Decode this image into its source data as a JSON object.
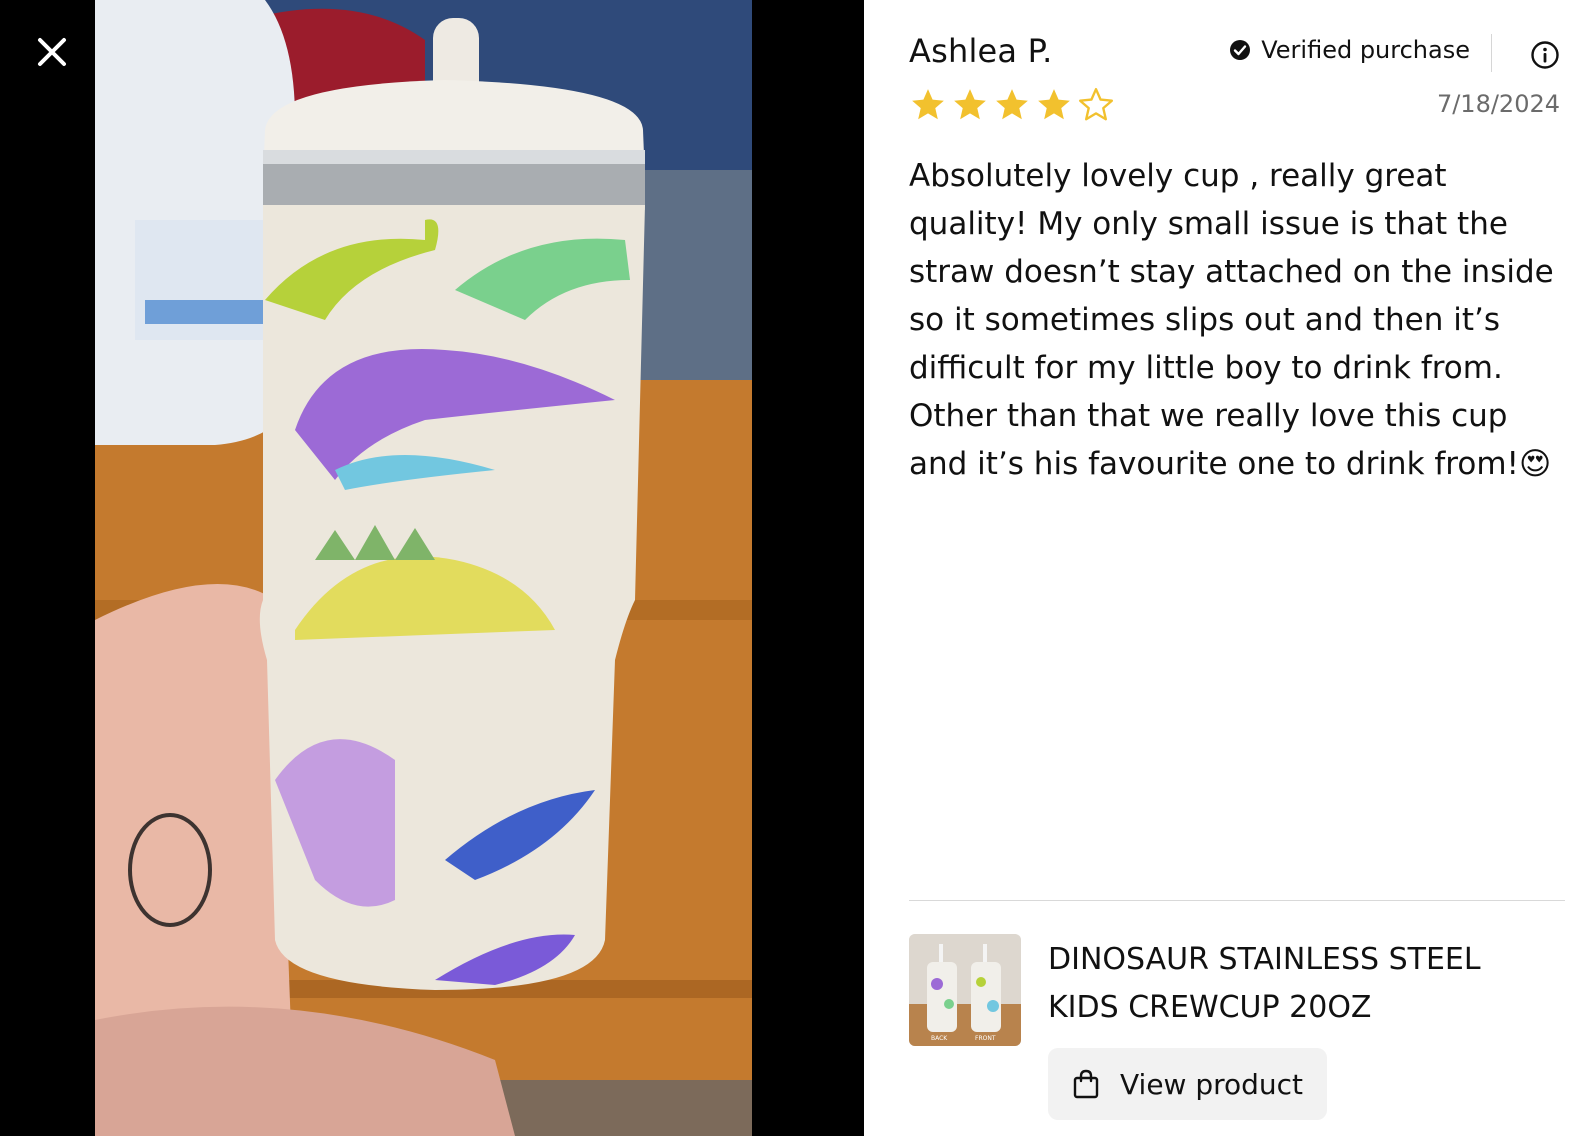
{
  "media": {
    "close_icon": "close-icon",
    "photo_alt": "Customer photo of dinosaur print tumbler"
  },
  "review": {
    "reviewer_name": "Ashlea P.",
    "verified_label": "Verified purchase",
    "verified_icon": "check-circle-icon",
    "info_icon": "info-icon",
    "rating": 4,
    "rating_max": 5,
    "star_color": "#F2C12E",
    "date": "7/18/2024",
    "body": "Absolutely lovely cup , really great quality! My only small issue is that the straw doesn’t stay attached on the inside so it sometimes slips out and then it’s difficult for my little boy to drink from. Other than that we really love this cup and it’s his favourite one to drink from!😍"
  },
  "product": {
    "title": "DINOSAUR STAINLESS STEEL KIDS CREWCUP 20OZ",
    "thumb_labels": [
      "BACK",
      "FRONT"
    ],
    "view_label": "View product",
    "view_icon": "shopping-bag-icon"
  }
}
